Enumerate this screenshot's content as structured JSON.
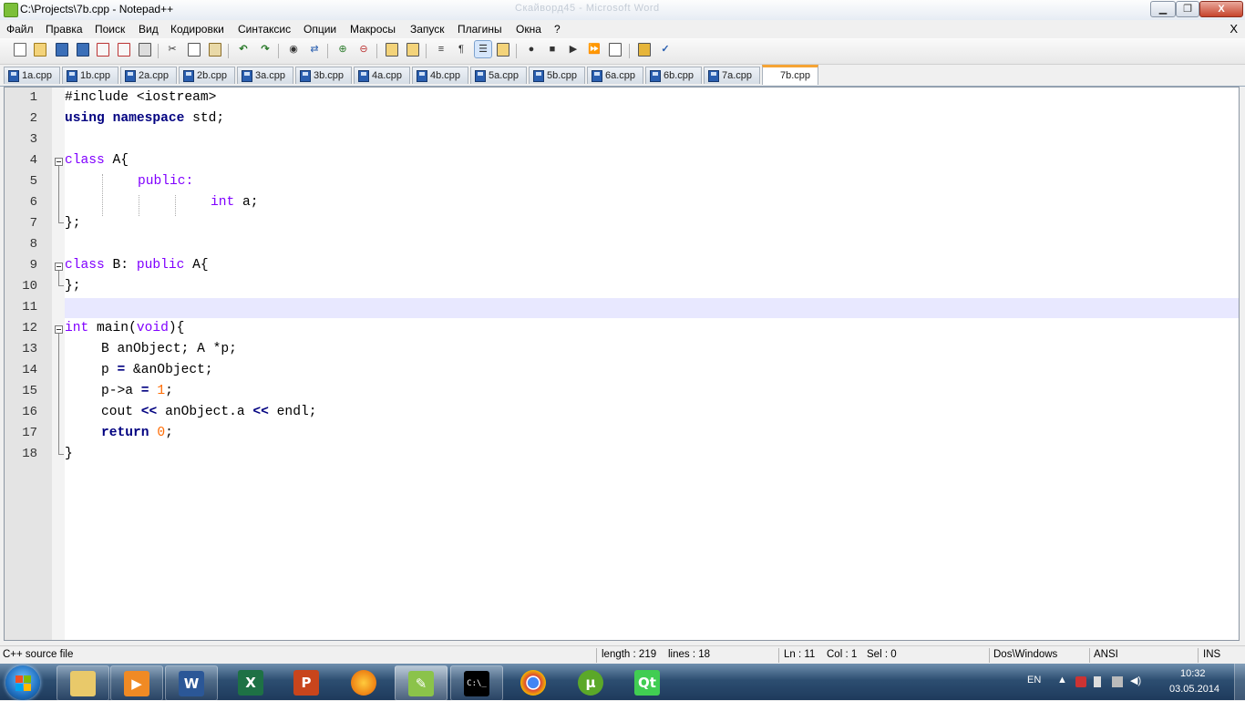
{
  "window": {
    "title": "C:\\Projects\\7b.cpp - Notepad++",
    "faded_text": "Скайворд45 - Microsoft Word",
    "minimize": "▁",
    "maximize": "❐",
    "close": "X"
  },
  "menu": {
    "items": [
      "Файл",
      "Правка",
      "Поиск",
      "Вид",
      "Кодировки",
      "Синтаксис",
      "Опции",
      "Макросы",
      "Запуск",
      "Плагины",
      "Окна",
      "?"
    ],
    "close_doc": "X"
  },
  "toolbar": {
    "icons": [
      "new-file-icon",
      "open-file-icon",
      "save-icon",
      "save-all-icon",
      "close-icon",
      "close-all-icon",
      "print-icon",
      "cut-icon",
      "copy-icon",
      "paste-icon",
      "undo-icon",
      "redo-icon",
      "find-icon",
      "replace-icon",
      "zoom-in-icon",
      "zoom-out-icon",
      "sync-v-icon",
      "sync-h-icon",
      "word-wrap-icon",
      "show-all-chars-icon",
      "indent-guide-icon",
      "user-lang-icon",
      "record-macro-icon",
      "stop-record-icon",
      "play-macro-icon",
      "run-multiple-macro-icon",
      "save-macro-icon",
      "run-icon",
      "spellcheck-icon"
    ]
  },
  "tabs": [
    "1a.cpp",
    "1b.cpp",
    "2a.cpp",
    "2b.cpp",
    "3a.cpp",
    "3b.cpp",
    "4a.cpp",
    "4b.cpp",
    "5a.cpp",
    "5b.cpp",
    "6a.cpp",
    "6b.cpp",
    "7a.cpp",
    "7b.cpp"
  ],
  "active_tab": "7b.cpp",
  "editor": {
    "line_numbers": [
      "1",
      "2",
      "3",
      "4",
      "5",
      "6",
      "7",
      "8",
      "9",
      "10",
      "11",
      "12",
      "13",
      "14",
      "15",
      "16",
      "17",
      "18"
    ],
    "current_line": 11,
    "code": {
      "l1": "#include <iostream>",
      "l2_kw1": "using",
      "l2_kw2": "namespace",
      "l2_rest": " std;",
      "l4_kw": "class",
      "l4_rest": " A{",
      "l5_kw": "public:",
      "l6_kw": "int",
      "l6_rest": " a;",
      "l7": "};",
      "l9_kw": "class",
      "l9_mid": " B: ",
      "l9_kw2": "public",
      "l9_rest": " A{",
      "l10": "};",
      "l12_kw": "int",
      "l12_mid": " main(",
      "l12_kw2": "void",
      "l12_rest": "){",
      "l13": "B anObject; A *p;",
      "l14_a": "p ",
      "l14_op": "=",
      "l14_b": " &anObject;",
      "l15_a": "p->a ",
      "l15_op": "=",
      "l15_sp": " ",
      "l15_num": "1",
      "l15_end": ";",
      "l16_a": "cout ",
      "l16_op1": "<<",
      "l16_b": " anObject.a ",
      "l16_op2": "<<",
      "l16_c": " endl;",
      "l17_kw": "return",
      "l17_sp": " ",
      "l17_num": "0",
      "l17_end": ";",
      "l18": "}"
    }
  },
  "statusbar": {
    "file_type": "C++ source file",
    "length": "length : 219",
    "lines": "lines : 18",
    "ln": "Ln : 11",
    "col": "Col : 1",
    "sel": "Sel : 0",
    "eol": "Dos\\Windows",
    "encoding": "ANSI",
    "mode": "INS"
  },
  "taskbar": {
    "apps": [
      "explorer-icon",
      "media-player-icon",
      "word-icon",
      "excel-icon",
      "powerpoint-icon",
      "firefox-icon",
      "notepadpp-icon",
      "cmd-icon",
      "chrome-icon",
      "utorrent-icon",
      "qt-icon"
    ],
    "app_glyphs": {
      "word": "W",
      "excel": "X",
      "powerpoint": "P",
      "cmd": "C:\\_",
      "utorrent": "µ",
      "qt": "Qt"
    },
    "lang": "EN",
    "time": "10:32",
    "date": "03.05.2014",
    "colors": {
      "start": "#1f6fbf",
      "active_app": "#ffffff"
    }
  }
}
